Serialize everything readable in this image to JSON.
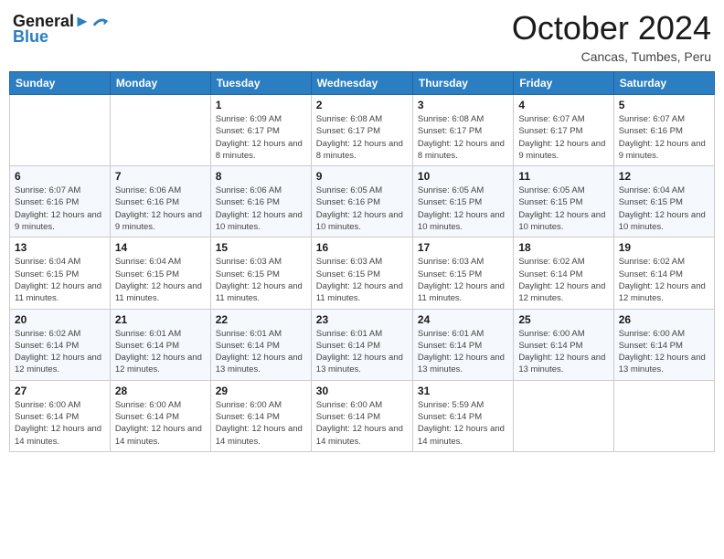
{
  "logo": {
    "line1": "General",
    "line2": "Blue"
  },
  "header": {
    "month": "October 2024",
    "location": "Cancas, Tumbes, Peru"
  },
  "weekdays": [
    "Sunday",
    "Monday",
    "Tuesday",
    "Wednesday",
    "Thursday",
    "Friday",
    "Saturday"
  ],
  "weeks": [
    [
      {
        "day": "",
        "sunrise": "",
        "sunset": "",
        "daylight": ""
      },
      {
        "day": "",
        "sunrise": "",
        "sunset": "",
        "daylight": ""
      },
      {
        "day": "1",
        "sunrise": "Sunrise: 6:09 AM",
        "sunset": "Sunset: 6:17 PM",
        "daylight": "Daylight: 12 hours and 8 minutes."
      },
      {
        "day": "2",
        "sunrise": "Sunrise: 6:08 AM",
        "sunset": "Sunset: 6:17 PM",
        "daylight": "Daylight: 12 hours and 8 minutes."
      },
      {
        "day": "3",
        "sunrise": "Sunrise: 6:08 AM",
        "sunset": "Sunset: 6:17 PM",
        "daylight": "Daylight: 12 hours and 8 minutes."
      },
      {
        "day": "4",
        "sunrise": "Sunrise: 6:07 AM",
        "sunset": "Sunset: 6:17 PM",
        "daylight": "Daylight: 12 hours and 9 minutes."
      },
      {
        "day": "5",
        "sunrise": "Sunrise: 6:07 AM",
        "sunset": "Sunset: 6:16 PM",
        "daylight": "Daylight: 12 hours and 9 minutes."
      }
    ],
    [
      {
        "day": "6",
        "sunrise": "Sunrise: 6:07 AM",
        "sunset": "Sunset: 6:16 PM",
        "daylight": "Daylight: 12 hours and 9 minutes."
      },
      {
        "day": "7",
        "sunrise": "Sunrise: 6:06 AM",
        "sunset": "Sunset: 6:16 PM",
        "daylight": "Daylight: 12 hours and 9 minutes."
      },
      {
        "day": "8",
        "sunrise": "Sunrise: 6:06 AM",
        "sunset": "Sunset: 6:16 PM",
        "daylight": "Daylight: 12 hours and 10 minutes."
      },
      {
        "day": "9",
        "sunrise": "Sunrise: 6:05 AM",
        "sunset": "Sunset: 6:16 PM",
        "daylight": "Daylight: 12 hours and 10 minutes."
      },
      {
        "day": "10",
        "sunrise": "Sunrise: 6:05 AM",
        "sunset": "Sunset: 6:15 PM",
        "daylight": "Daylight: 12 hours and 10 minutes."
      },
      {
        "day": "11",
        "sunrise": "Sunrise: 6:05 AM",
        "sunset": "Sunset: 6:15 PM",
        "daylight": "Daylight: 12 hours and 10 minutes."
      },
      {
        "day": "12",
        "sunrise": "Sunrise: 6:04 AM",
        "sunset": "Sunset: 6:15 PM",
        "daylight": "Daylight: 12 hours and 10 minutes."
      }
    ],
    [
      {
        "day": "13",
        "sunrise": "Sunrise: 6:04 AM",
        "sunset": "Sunset: 6:15 PM",
        "daylight": "Daylight: 12 hours and 11 minutes."
      },
      {
        "day": "14",
        "sunrise": "Sunrise: 6:04 AM",
        "sunset": "Sunset: 6:15 PM",
        "daylight": "Daylight: 12 hours and 11 minutes."
      },
      {
        "day": "15",
        "sunrise": "Sunrise: 6:03 AM",
        "sunset": "Sunset: 6:15 PM",
        "daylight": "Daylight: 12 hours and 11 minutes."
      },
      {
        "day": "16",
        "sunrise": "Sunrise: 6:03 AM",
        "sunset": "Sunset: 6:15 PM",
        "daylight": "Daylight: 12 hours and 11 minutes."
      },
      {
        "day": "17",
        "sunrise": "Sunrise: 6:03 AM",
        "sunset": "Sunset: 6:15 PM",
        "daylight": "Daylight: 12 hours and 11 minutes."
      },
      {
        "day": "18",
        "sunrise": "Sunrise: 6:02 AM",
        "sunset": "Sunset: 6:14 PM",
        "daylight": "Daylight: 12 hours and 12 minutes."
      },
      {
        "day": "19",
        "sunrise": "Sunrise: 6:02 AM",
        "sunset": "Sunset: 6:14 PM",
        "daylight": "Daylight: 12 hours and 12 minutes."
      }
    ],
    [
      {
        "day": "20",
        "sunrise": "Sunrise: 6:02 AM",
        "sunset": "Sunset: 6:14 PM",
        "daylight": "Daylight: 12 hours and 12 minutes."
      },
      {
        "day": "21",
        "sunrise": "Sunrise: 6:01 AM",
        "sunset": "Sunset: 6:14 PM",
        "daylight": "Daylight: 12 hours and 12 minutes."
      },
      {
        "day": "22",
        "sunrise": "Sunrise: 6:01 AM",
        "sunset": "Sunset: 6:14 PM",
        "daylight": "Daylight: 12 hours and 13 minutes."
      },
      {
        "day": "23",
        "sunrise": "Sunrise: 6:01 AM",
        "sunset": "Sunset: 6:14 PM",
        "daylight": "Daylight: 12 hours and 13 minutes."
      },
      {
        "day": "24",
        "sunrise": "Sunrise: 6:01 AM",
        "sunset": "Sunset: 6:14 PM",
        "daylight": "Daylight: 12 hours and 13 minutes."
      },
      {
        "day": "25",
        "sunrise": "Sunrise: 6:00 AM",
        "sunset": "Sunset: 6:14 PM",
        "daylight": "Daylight: 12 hours and 13 minutes."
      },
      {
        "day": "26",
        "sunrise": "Sunrise: 6:00 AM",
        "sunset": "Sunset: 6:14 PM",
        "daylight": "Daylight: 12 hours and 13 minutes."
      }
    ],
    [
      {
        "day": "27",
        "sunrise": "Sunrise: 6:00 AM",
        "sunset": "Sunset: 6:14 PM",
        "daylight": "Daylight: 12 hours and 14 minutes."
      },
      {
        "day": "28",
        "sunrise": "Sunrise: 6:00 AM",
        "sunset": "Sunset: 6:14 PM",
        "daylight": "Daylight: 12 hours and 14 minutes."
      },
      {
        "day": "29",
        "sunrise": "Sunrise: 6:00 AM",
        "sunset": "Sunset: 6:14 PM",
        "daylight": "Daylight: 12 hours and 14 minutes."
      },
      {
        "day": "30",
        "sunrise": "Sunrise: 6:00 AM",
        "sunset": "Sunset: 6:14 PM",
        "daylight": "Daylight: 12 hours and 14 minutes."
      },
      {
        "day": "31",
        "sunrise": "Sunrise: 5:59 AM",
        "sunset": "Sunset: 6:14 PM",
        "daylight": "Daylight: 12 hours and 14 minutes."
      },
      {
        "day": "",
        "sunrise": "",
        "sunset": "",
        "daylight": ""
      },
      {
        "day": "",
        "sunrise": "",
        "sunset": "",
        "daylight": ""
      }
    ]
  ]
}
